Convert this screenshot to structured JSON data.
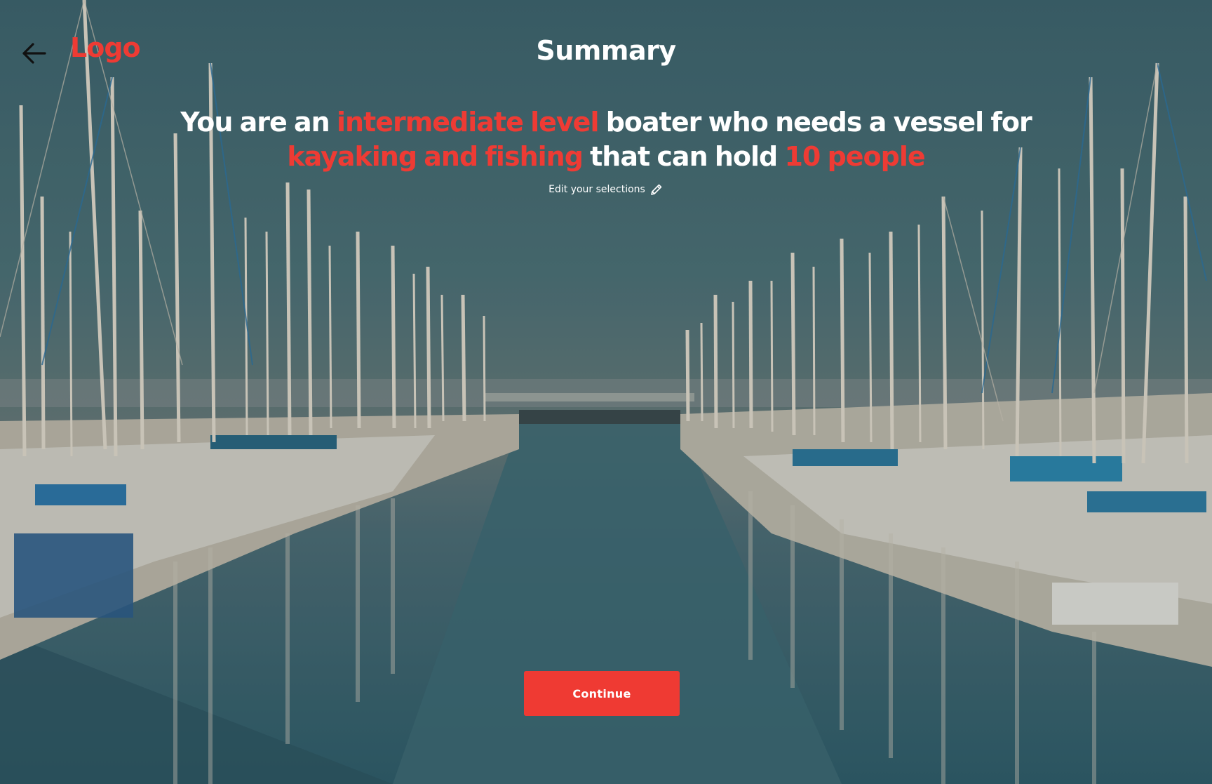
{
  "header": {
    "logo_text": "Logo",
    "title": "Summary"
  },
  "summary": {
    "part1": "You are an",
    "level": "intermediate level",
    "part2": "boater who needs a vessel for",
    "activities": "kayaking and fishing",
    "part3": "that can hold",
    "capacity": "10 people"
  },
  "edit": {
    "label": "Edit your selections",
    "icon": "pencil-icon"
  },
  "actions": {
    "continue_label": "Continue"
  },
  "icons": {
    "back": "arrow-left-icon"
  },
  "colors": {
    "accent": "#ee3b34",
    "text": "#ffffff",
    "button": "#ef3a33"
  }
}
